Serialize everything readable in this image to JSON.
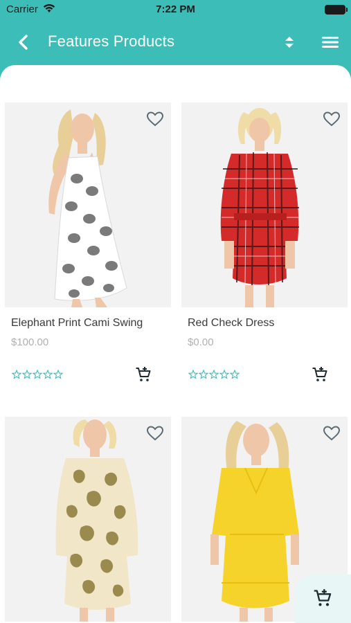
{
  "status": {
    "carrier": "Carrier",
    "time": "7:22 PM"
  },
  "header": {
    "title": "Features Products",
    "back_icon": "chevron-left-icon",
    "sort_icon": "sort-icon",
    "menu_icon": "hamburger-menu-icon"
  },
  "colors": {
    "brand": "#3dbdb8",
    "star": "#3dbdb8",
    "price": "#b0b0b0"
  },
  "products": [
    {
      "name": "Elephant Print Cami Swing",
      "price": "$100.00",
      "rating": 0
    },
    {
      "name": "Red Check Dress",
      "price": "$0.00",
      "rating": 0
    },
    {
      "name": "",
      "price": "",
      "rating": 0
    },
    {
      "name": "",
      "price": "",
      "rating": 0
    }
  ]
}
